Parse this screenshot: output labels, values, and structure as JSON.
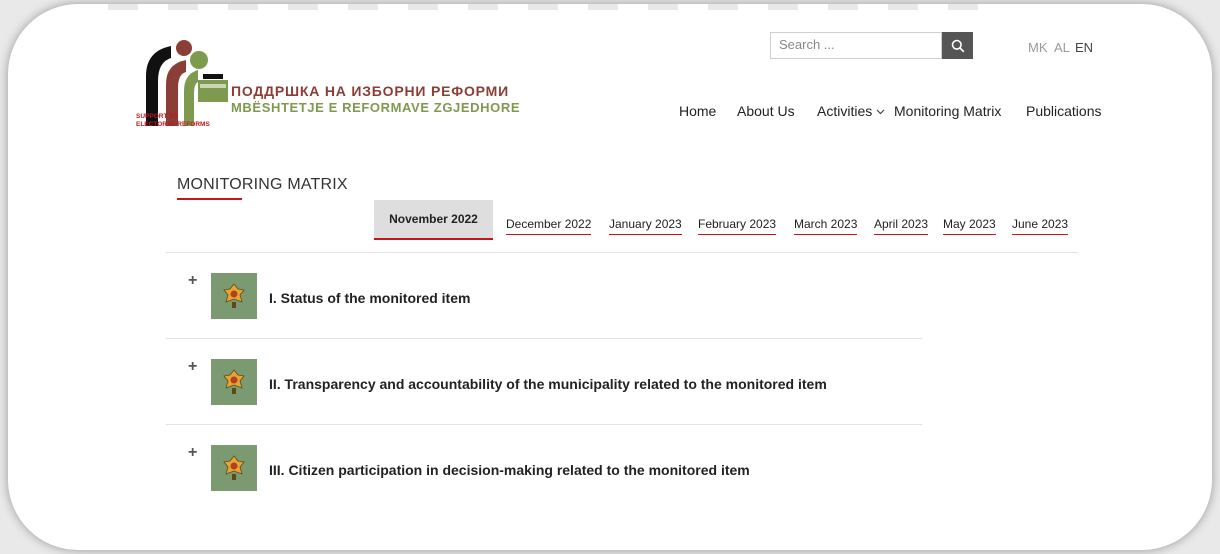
{
  "logo": {
    "line_mk": "ПОДДРШКА НА ИЗБОРНИ РЕФОРМИ",
    "line_al": "MBËSHTETJE E REFORMAVE ZGJEDHORE",
    "small_1": "SUPPORT TO",
    "small_2": "ELECTORAL REFORMS",
    "colors": {
      "brown": "#8a3e36",
      "green": "#7e9a4e",
      "red": "#c2171d"
    }
  },
  "search": {
    "placeholder": "Search ...",
    "icon": "search-icon"
  },
  "languages": [
    "MK",
    "AL",
    "EN"
  ],
  "active_language": "EN",
  "nav": {
    "home": "Home",
    "about": "About Us",
    "activities": "Activities",
    "matrix": "Monitoring Matrix",
    "publications": "Publications"
  },
  "page": {
    "title": "MONITORING MATRIX"
  },
  "months": {
    "active": "November 2022",
    "items": [
      "December 2022",
      "January 2023",
      "February 2023",
      "March 2023",
      "April 2023",
      "May 2023",
      "June 2023"
    ]
  },
  "sections": [
    {
      "toggle": "+",
      "title": "I. Status of the monitored item",
      "icon": "emblem-icon"
    },
    {
      "toggle": "+",
      "title": "II. Transparency and accountability of the municipality related to the monitored item",
      "icon": "emblem-icon"
    },
    {
      "toggle": "+",
      "title": "III. Citizen participation in decision-making related to the monitored item",
      "icon": "emblem-icon"
    }
  ],
  "colors": {
    "accent": "#c8151b",
    "icon_bg": "#7b9a71",
    "search_button": "#555555"
  }
}
